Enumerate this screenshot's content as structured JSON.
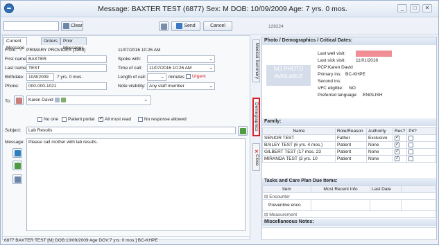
{
  "window": {
    "title": "Message: BAXTER TEST (6877) Sex: M DOB: 10/09/2009 Age: 7 yrs. 0 mos.",
    "controls": [
      "_",
      "□",
      "✕"
    ]
  },
  "toolbar": {
    "clear_label": "Clear",
    "send_label": "Send",
    "cancel_label": "Cancel",
    "id_label": "128224"
  },
  "tabs": [
    "Current Message",
    "Orders",
    "Prior Messages"
  ],
  "form": {
    "from_label": "From:",
    "from_value": "PRIMARY PROVIDER [1068]",
    "from_datetime": "11/07/2016 10:26 AM",
    "first_label": "First name:",
    "first_value": "BAXTER",
    "spoke_label": "Spoke with:",
    "last_label": "Last name:",
    "last_value": "TEST",
    "time_label": "Time of call:",
    "time_value": "11/07/2016 10:26 AM",
    "birth_label": "Birthdate:",
    "birth_value": "10/9/2009",
    "age_value": "7 yrs. 0 mos.",
    "length_label": "Length of call:",
    "minutes_label": "minutes",
    "urgent_label": "Urgent",
    "phone_label": "Phone:",
    "phone_value": "000-000-1021",
    "visibility_label": "Note visibility:",
    "visibility_value": "Any staff member",
    "to_label": "To:",
    "to_value": "Karen David",
    "opt_none": "No one",
    "opt_portal": "Patient portal",
    "opt_all": "All must read",
    "opt_noresp": "No response allowed",
    "subject_label": "Subject:",
    "subject_value": "Lab Results",
    "message_label": "Message:",
    "message_value": "Please call mother with lab results."
  },
  "sidebar": {
    "medical_summary": "Medical Summary",
    "demographics": "Demographics",
    "close": "Close"
  },
  "demographics": {
    "header": "Photo / Demographics / Critical Dates:",
    "no_photo": "NO PHOTO AVAILABLE",
    "last_well_label": "Last well visit:",
    "last_sick_label": "Last sick visit:",
    "last_sick_value": "11/01/2016",
    "pcp_label": "PCP:",
    "pcp_value": "Karen David",
    "primary_ins_label": "Primary ins:",
    "primary_ins_value": "BC-KHPE",
    "second_ins_label": "Second ins:",
    "vfc_label": "VFC eligible:",
    "vfc_value": "NO",
    "lang_label": "Preferred language:",
    "lang_value": "ENGLISH"
  },
  "family": {
    "header": "Family:",
    "columns": [
      "Name",
      "Role/Reason",
      "Authority",
      "Res?",
      "Pri?"
    ],
    "rows": [
      {
        "name": "SENIOR TEST",
        "role": "Father",
        "authority": "Exclusive",
        "res": true,
        "pri": false
      },
      {
        "name": "BAILEY TEST (6 yrs. 4 mos.)",
        "role": "Patient",
        "authority": "None",
        "res": true,
        "pri": false
      },
      {
        "name": "GILBERT TEST (17 mos. 23",
        "role": "Patient",
        "authority": "None",
        "res": true,
        "pri": false
      },
      {
        "name": "MIRANDA TEST (3 yrs. 10",
        "role": "Patient",
        "authority": "None",
        "res": true,
        "pri": false
      }
    ]
  },
  "care_plan": {
    "header": "Tasks and Care Plan Due Items:",
    "columns": [
      "Item",
      "Most Recent Info",
      "Last Date"
    ],
    "group1": "Encounter",
    "item1": "Preventive enco",
    "group2": "Measurement"
  },
  "misc": {
    "header": "Miscellaneous Notes:"
  },
  "status_bar": "6877 BAXTER TEST [M] DOB:10/09/2009 Age DOV:7 yrs. 0 mos.] BC-KHPE"
}
